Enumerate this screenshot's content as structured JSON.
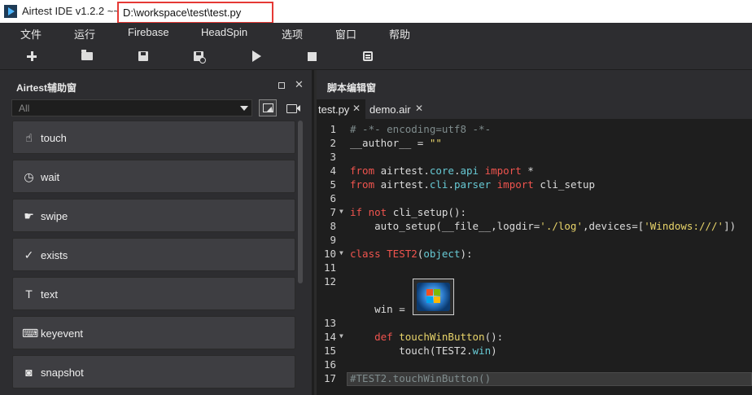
{
  "window": {
    "app_title": "Airtest IDE v1.2.2 ~~",
    "file_path": "D:\\workspace\\test\\test.py"
  },
  "menu": {
    "items": [
      "文件",
      "运行",
      "Firebase",
      "HeadSpin",
      "选项",
      "窗口",
      "帮助"
    ]
  },
  "toolbar": {
    "buttons": [
      "new-file-icon",
      "open-folder-icon",
      "save-icon",
      "save-as-icon",
      "run-icon",
      "stop-icon",
      "log-icon"
    ]
  },
  "assistant_panel": {
    "title": "Airtest辅助窗",
    "filter_value": "All",
    "api_buttons": [
      {
        "label": "touch",
        "icon": "touch-icon"
      },
      {
        "label": "wait",
        "icon": "clock-icon"
      },
      {
        "label": "swipe",
        "icon": "swipe-icon"
      },
      {
        "label": "exists",
        "icon": "check-circle-icon"
      },
      {
        "label": "text",
        "icon": "text-icon"
      },
      {
        "label": "keyevent",
        "icon": "keyboard-icon"
      },
      {
        "label": "snapshot",
        "icon": "camera-icon"
      }
    ]
  },
  "editor": {
    "title": "脚本编辑窗",
    "tabs": [
      {
        "label": "test.py",
        "active": true
      },
      {
        "label": "demo.air",
        "active": false
      }
    ],
    "line_numbers": [
      "1",
      "2",
      "3",
      "4",
      "5",
      "6",
      "7",
      "8",
      "9",
      "10",
      "11",
      "12",
      "13",
      "14",
      "15",
      "16",
      "17"
    ],
    "code": {
      "l1": "# -*- encoding=utf8 -*-",
      "l2a": "__author__ = ",
      "l2b": "\"\"",
      "l4a": "from ",
      "l4b": "airtest",
      "l4c": ".",
      "l4d": "core",
      "l4e": ".",
      "l4f": "api",
      "l4g": " import ",
      "l4h": "*",
      "l5a": "from ",
      "l5b": "airtest",
      "l5c": ".",
      "l5d": "cli",
      "l5e": ".",
      "l5f": "parser",
      "l5g": " import ",
      "l5h": "cli_setup",
      "l7a": "if not ",
      "l7b": "cli_setup():",
      "l8a": "    auto_setup(__file__,logdir=",
      "l8b": "'./log'",
      "l8c": ",devices=[",
      "l8d": "'Windows:///'",
      "l8e": "])",
      "l10a": "class ",
      "l10b": "TEST2",
      "l10c": "(",
      "l10d": "object",
      "l10e": "):",
      "l13": "    win = ",
      "l14a": "    def ",
      "l14b": "touchWinButton",
      "l14c": "():",
      "l15a": "        touch(TEST2.",
      "l15b": "win",
      "l15c": ")",
      "l17": "#TEST2.touchWinButton()"
    }
  }
}
